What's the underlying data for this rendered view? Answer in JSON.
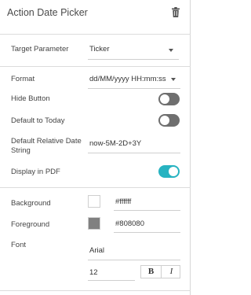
{
  "header": {
    "title": "Action Date Picker",
    "delete_icon": "trash-icon"
  },
  "target_parameter": {
    "label": "Target Parameter",
    "value": "Ticker"
  },
  "format": {
    "label": "Format",
    "value": "dd/MM/yyyy HH:mm:ss"
  },
  "hide_button": {
    "label": "Hide Button",
    "on": false
  },
  "default_to_today": {
    "label": "Default to Today",
    "on": false
  },
  "default_relative_date": {
    "label": "Default Relative Date String",
    "value": "now-5M-2D+3Y"
  },
  "display_in_pdf": {
    "label": "Display in PDF",
    "on": true
  },
  "background": {
    "label": "Background",
    "color": "#ffffff",
    "hex": "#ffffff"
  },
  "foreground": {
    "label": "Foreground",
    "color": "#808080",
    "hex": "#808080"
  },
  "font": {
    "label": "Font",
    "family": "Arial",
    "size": "12",
    "bold_label": "B",
    "italic_label": "I"
  },
  "colors": {
    "toggle_on": "#27b3c1",
    "toggle_off": "#6f6f6f"
  }
}
